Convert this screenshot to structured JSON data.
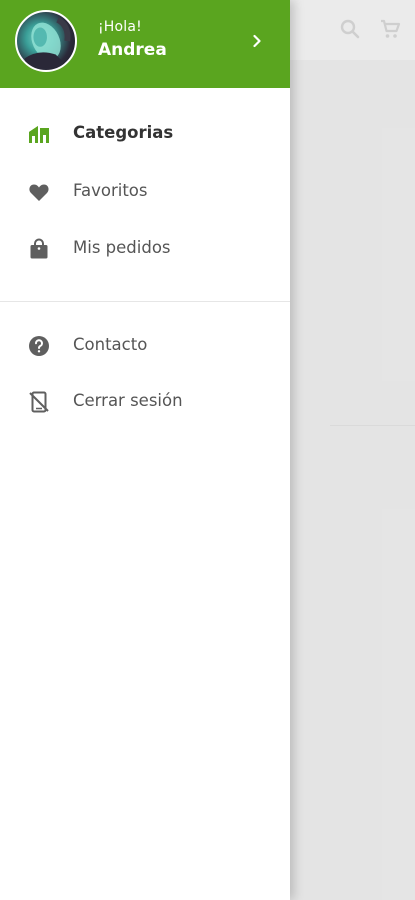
{
  "header": {
    "greeting": "¡Hola!",
    "username": "Andrea",
    "background_color": "#5aa51f"
  },
  "icons": {
    "search": "search-icon",
    "cart": "cart-icon",
    "chevron": "chevron-right-icon"
  },
  "menu": {
    "primary": [
      {
        "label": "Categorias",
        "icon": "home-icon",
        "active": true
      },
      {
        "label": "Favoritos",
        "icon": "heart-icon",
        "active": false
      },
      {
        "label": "Mis pedidos",
        "icon": "shopping-bag-icon",
        "active": false
      }
    ],
    "secondary": [
      {
        "label": "Contacto",
        "icon": "help-icon",
        "active": false
      },
      {
        "label": "Cerrar sesión",
        "icon": "logout-phone-icon",
        "active": false
      }
    ]
  },
  "colors": {
    "accent": "#5aa51f",
    "icon_gray": "#5f5f5f",
    "text_gray": "#555555"
  }
}
